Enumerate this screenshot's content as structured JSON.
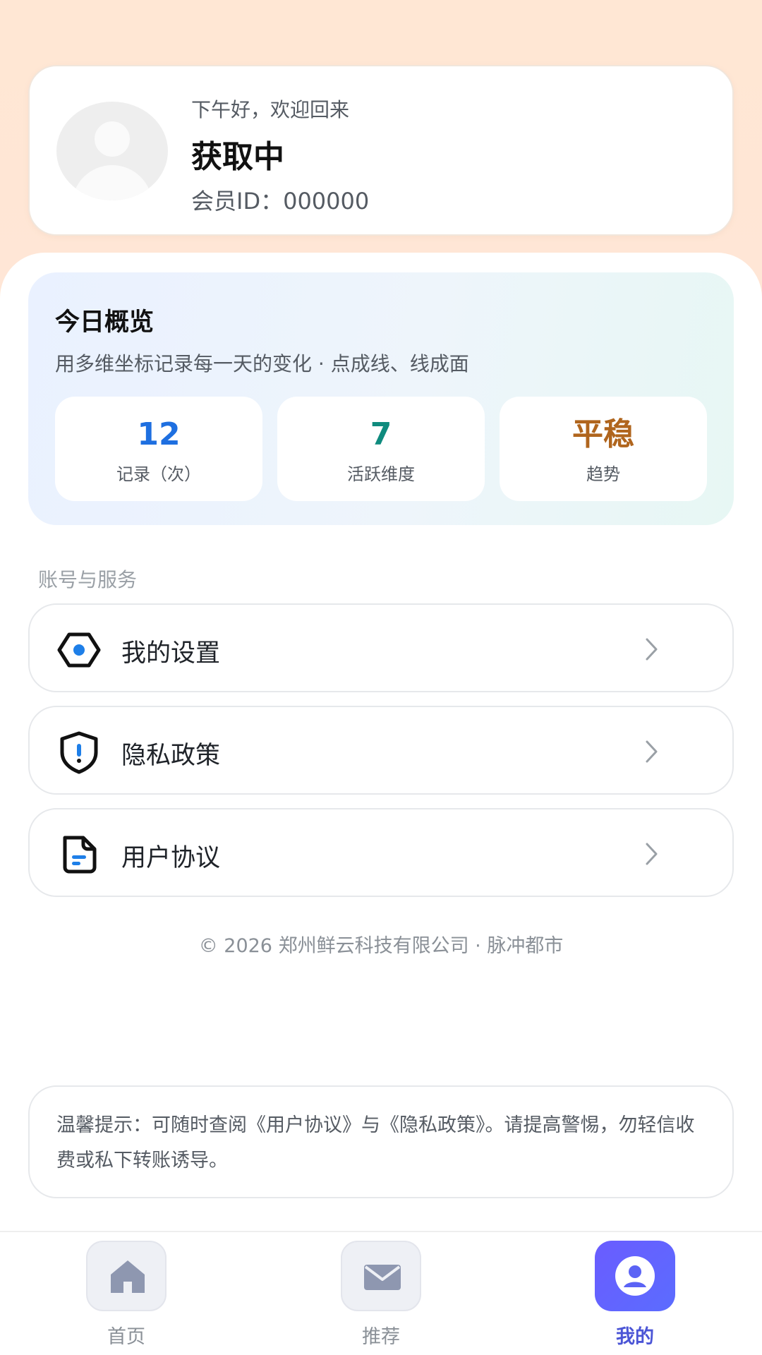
{
  "profile": {
    "greeting": "下午好，欢迎回来",
    "username": "获取中",
    "member_id": "会员ID：000000"
  },
  "overview": {
    "title": "今日概览",
    "subtitle": "用多维坐标记录每一天的变化 · 点成线、线成面",
    "stats": [
      {
        "value": "12",
        "label": "记录（次）",
        "color": "#1e6fe0"
      },
      {
        "value": "7",
        "label": "活跃维度",
        "color": "#0f8b7e"
      },
      {
        "value": "平稳",
        "label": "趋势",
        "color": "#b0651d"
      }
    ]
  },
  "section_label": "账号与服务",
  "menu": [
    {
      "label": "我的设置",
      "icon": "settings-hexagon-icon"
    },
    {
      "label": "隐私政策",
      "icon": "shield-icon"
    },
    {
      "label": "用户协议",
      "icon": "document-icon"
    }
  ],
  "copyright": "© 2026 郑州鲜云科技有限公司 · 脉冲都市",
  "tip": "温馨提示：可随时查阅《用户协议》与《隐私政策》。请提高警惕，勿轻信收费或私下转账诱导。",
  "tabs": [
    {
      "label": "首页",
      "icon": "home-icon",
      "active": false
    },
    {
      "label": "推荐",
      "icon": "mail-icon",
      "active": false
    },
    {
      "label": "我的",
      "icon": "user-icon",
      "active": true
    }
  ],
  "colors": {
    "accent": "#5b63f5",
    "header_bg": "#ffe7d4"
  }
}
